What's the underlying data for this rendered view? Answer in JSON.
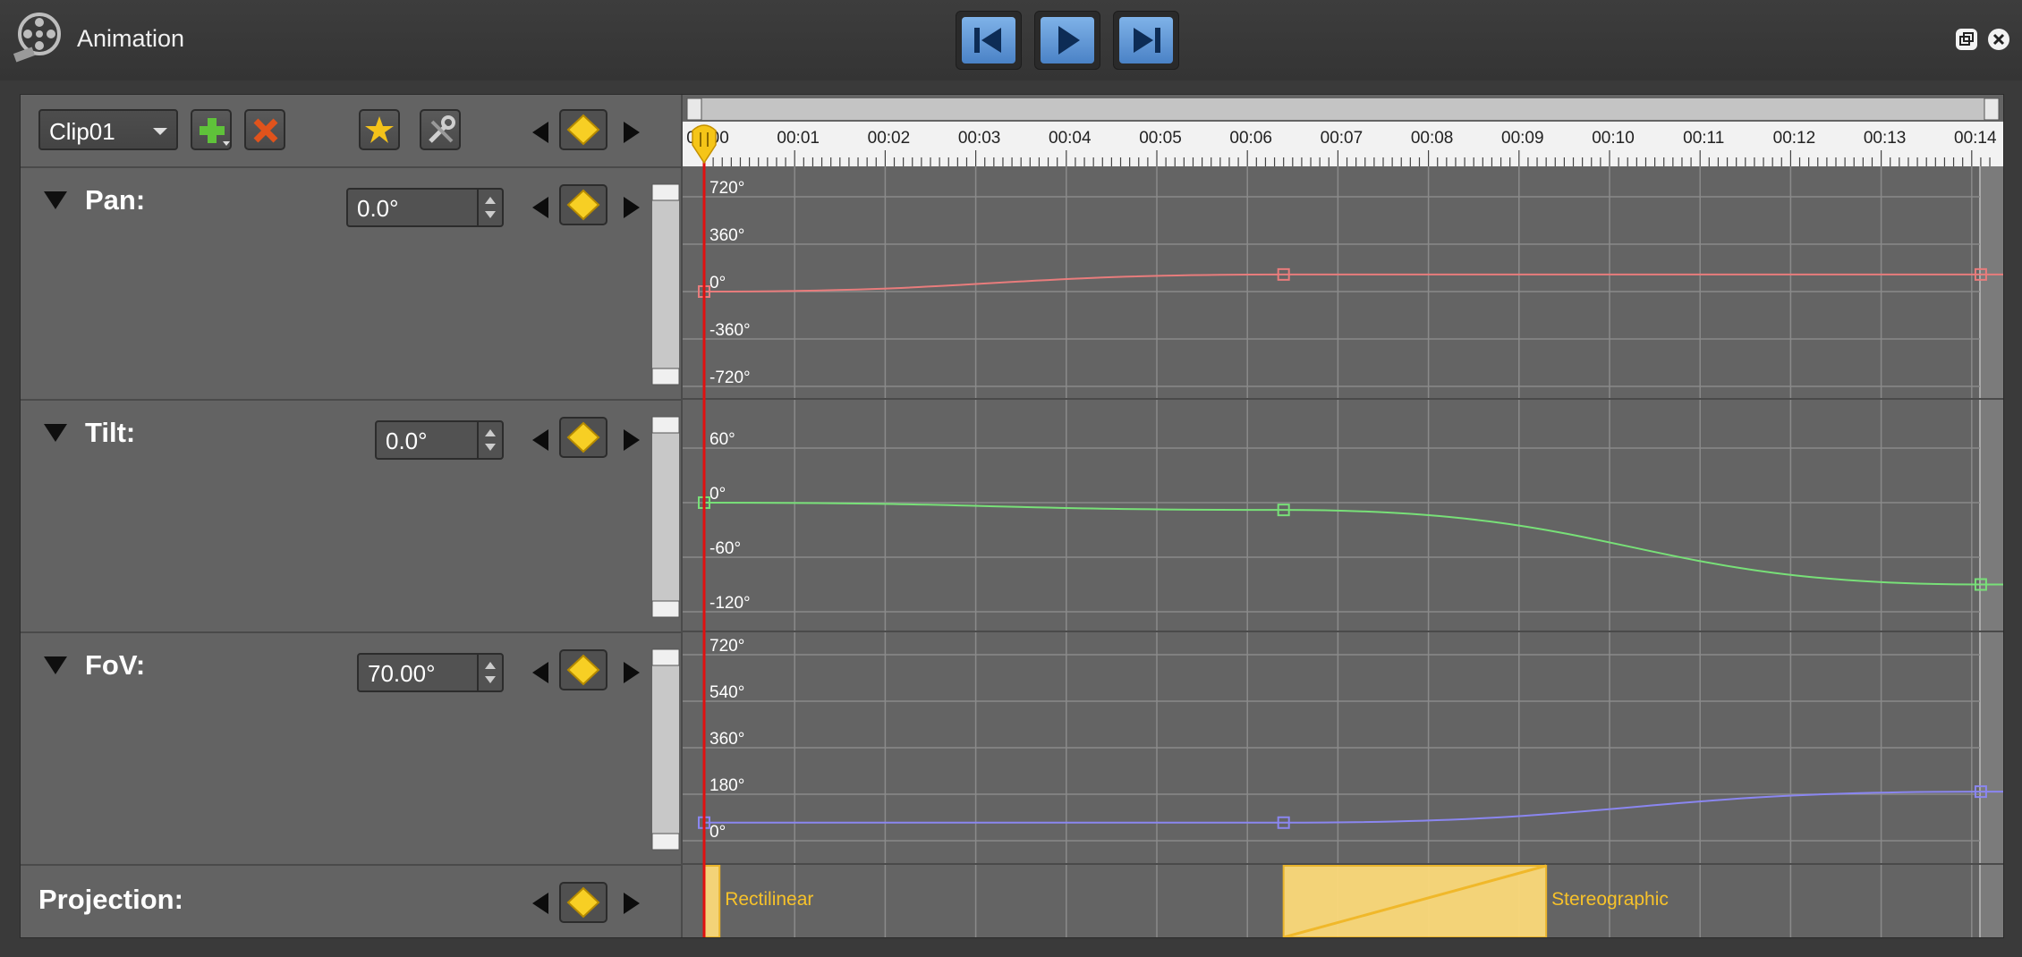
{
  "app": {
    "title": "Animation"
  },
  "transport": {
    "prev_label": "Go to start",
    "play_label": "Play",
    "next_label": "Go to end"
  },
  "toolbar": {
    "clip": "Clip01"
  },
  "tracks": {
    "pan": {
      "label": "Pan:",
      "value": "0.0°"
    },
    "tilt": {
      "label": "Tilt:",
      "value": "0.0°"
    },
    "fov": {
      "label": "FoV:",
      "value": "70.00°"
    },
    "projection": {
      "label": "Projection:"
    }
  },
  "ruler": {
    "ticks": [
      "00:00",
      "00:01",
      "00:02",
      "00:03",
      "00:04",
      "00:05",
      "00:06",
      "00:07",
      "00:08",
      "00:09",
      "00:10",
      "00:11",
      "00:12",
      "00:13",
      "00:14"
    ],
    "playhead_time": 0.0
  },
  "axes": {
    "pan": [
      "720°",
      "360°",
      "0°",
      "-360°",
      "-720°"
    ],
    "tilt": [
      "60°",
      "0°",
      "-60°",
      "-120°"
    ],
    "fov": [
      "720°",
      "540°",
      "360°",
      "180°",
      "0°"
    ]
  },
  "keyframes": {
    "pan": [
      {
        "t": 0,
        "v": 0
      },
      {
        "t": 6.4,
        "v": 130
      },
      {
        "t": 14.1,
        "v": 130
      }
    ],
    "tilt": [
      {
        "t": 0,
        "v": 0
      },
      {
        "t": 6.4,
        "v": -8
      },
      {
        "t": 14.1,
        "v": -90
      }
    ],
    "fov": [
      {
        "t": 0,
        "v": 70
      },
      {
        "t": 6.4,
        "v": 70
      },
      {
        "t": 14.1,
        "v": 190
      }
    ]
  },
  "projection_segments": [
    {
      "label": "Rectilinear",
      "start": 0.0,
      "end": 0.17
    },
    {
      "label": "Stereographic",
      "start": 6.4,
      "end": 9.3
    }
  ],
  "colors": {
    "pan": "#e87c7c",
    "tilt": "#78e078",
    "fov": "#8a86f0",
    "playhead": "#e01010",
    "keyframe": "#f5c518"
  }
}
